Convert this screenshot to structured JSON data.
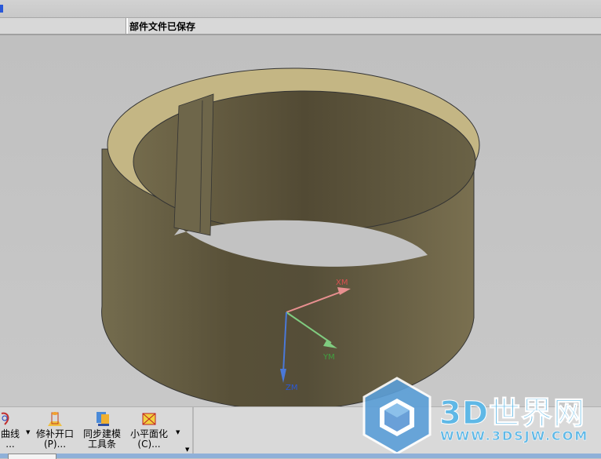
{
  "status": {
    "message": "部件文件已保存"
  },
  "toolbar": {
    "items": [
      {
        "label": "曲线",
        "sub": "...",
        "icon": "curve-icon"
      },
      {
        "label": "修补开口",
        "sub": "(P)...",
        "icon": "patch-opening-icon"
      },
      {
        "label": "同步建模",
        "sub": "工具条",
        "icon": "synchronous-modeling-icon"
      },
      {
        "label": "小平面化",
        "sub": "(C)...",
        "icon": "facet-icon"
      }
    ]
  },
  "axes": {
    "x": "XM",
    "y": "YM",
    "z": "ZM"
  },
  "watermark": {
    "name": "3D世界网",
    "url": "WWW.3DSJW.COM"
  },
  "colors": {
    "model": "#6a6448",
    "model_top": "#c6b887",
    "x_axis": "#e88888",
    "y_axis": "#6cc86c",
    "z_axis": "#4a78d8",
    "background": "#c4c4c4"
  }
}
